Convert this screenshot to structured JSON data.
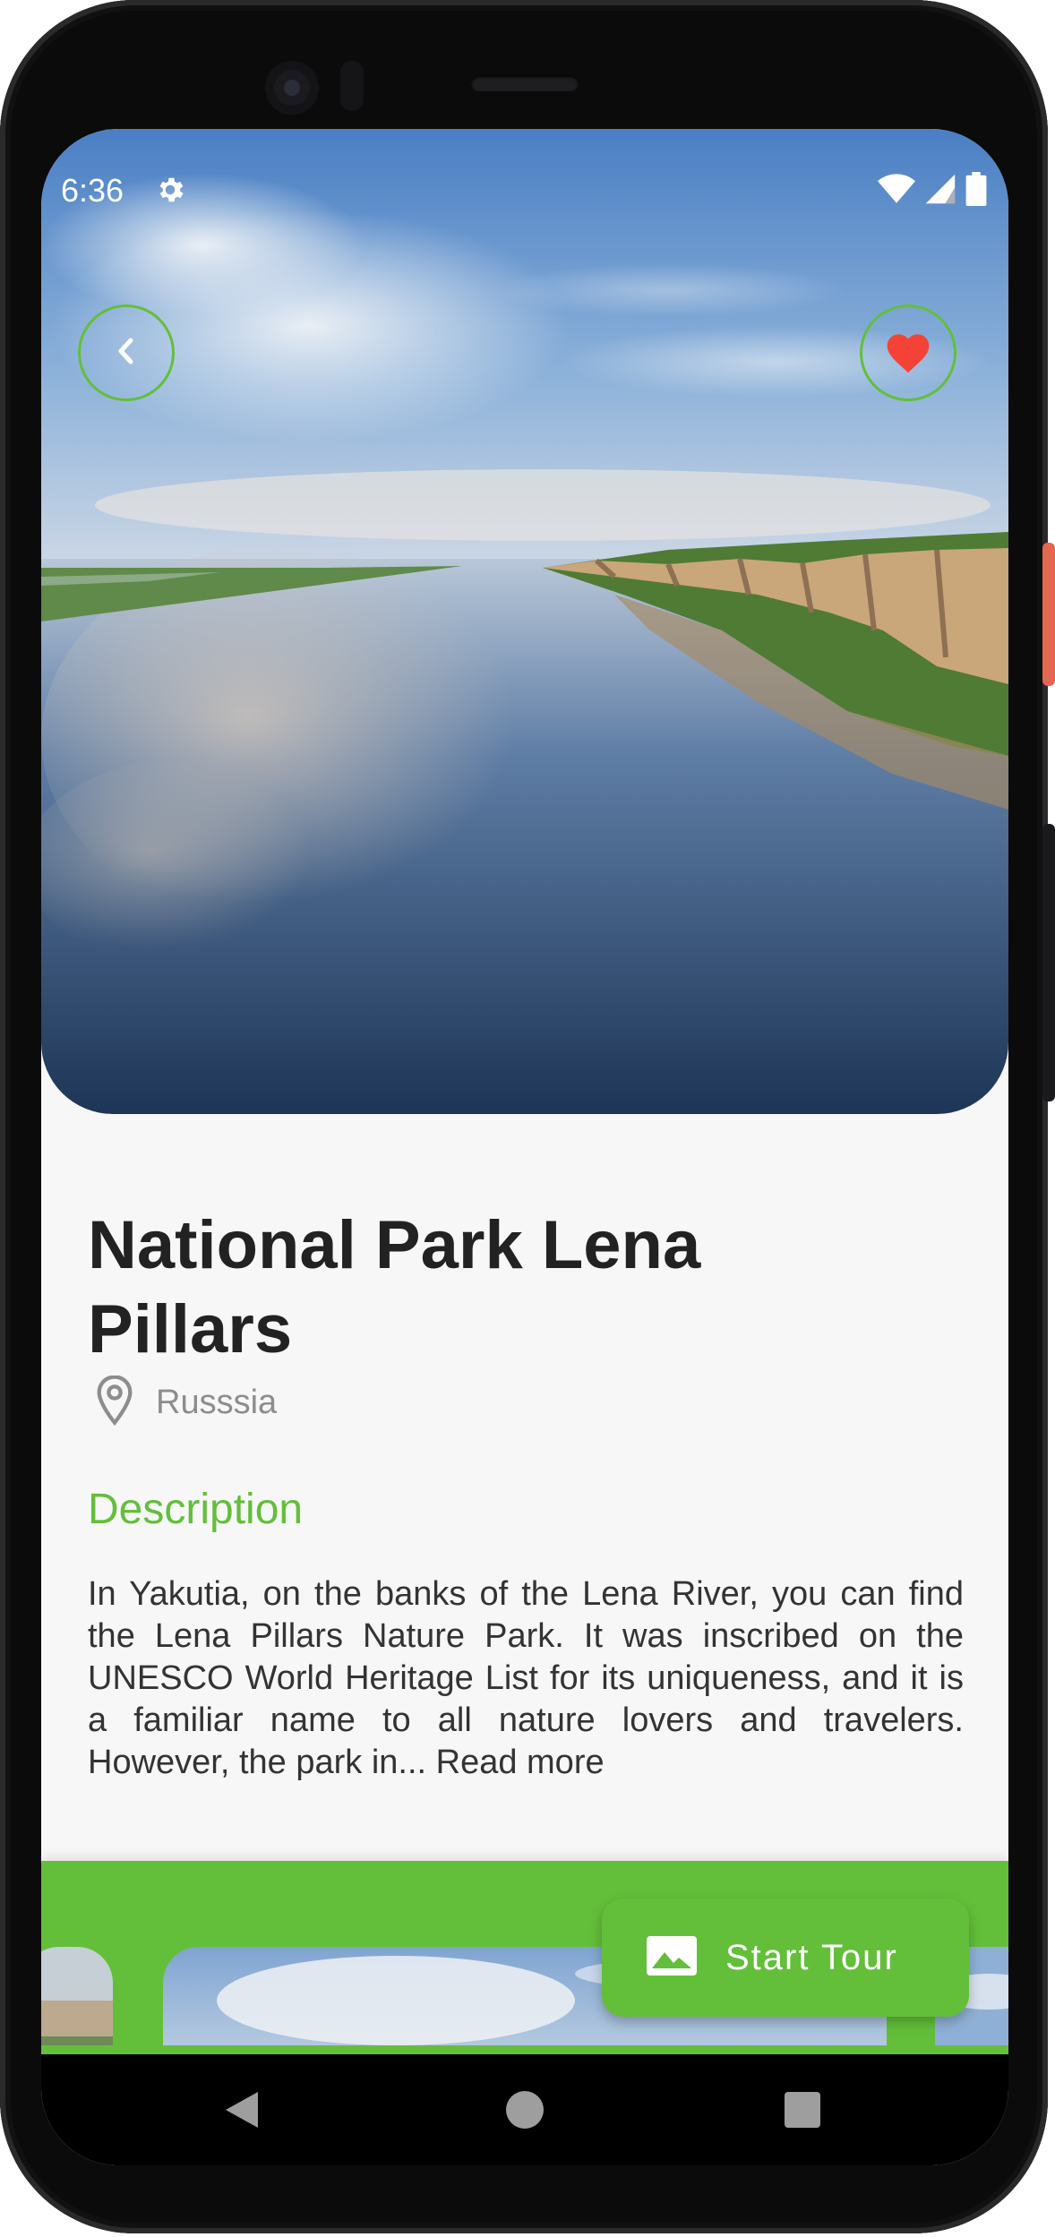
{
  "status_bar": {
    "time": "6:36",
    "settings_icon": "gear-icon",
    "wifi_icon": "wifi-icon",
    "signal_icon": "signal-icon",
    "battery_icon": "battery-icon"
  },
  "header": {
    "back_icon": "chevron-left-icon",
    "favorite_icon": "heart-icon",
    "favorite_color": "#f44336",
    "accent": "#63bf3a"
  },
  "place": {
    "title": "National Park Lena Pillars",
    "location_icon": "location-pin-icon",
    "location": "Russsia",
    "description_heading": "Description",
    "description": "In Yakutia, on the banks of the Lena River, you can find the Lena Pillars Nature Park. It was inscribed on the UNESCO World Heritage List for its uniqueness, and it is a familiar name to all nature lovers and travelers. However, the park in... Read more"
  },
  "tour_button": {
    "label": "Start Tour",
    "icon": "landscape-icon"
  },
  "nav_bar": {
    "back": "triangle-back-icon",
    "home": "circle-home-icon",
    "recents": "square-recents-icon"
  }
}
